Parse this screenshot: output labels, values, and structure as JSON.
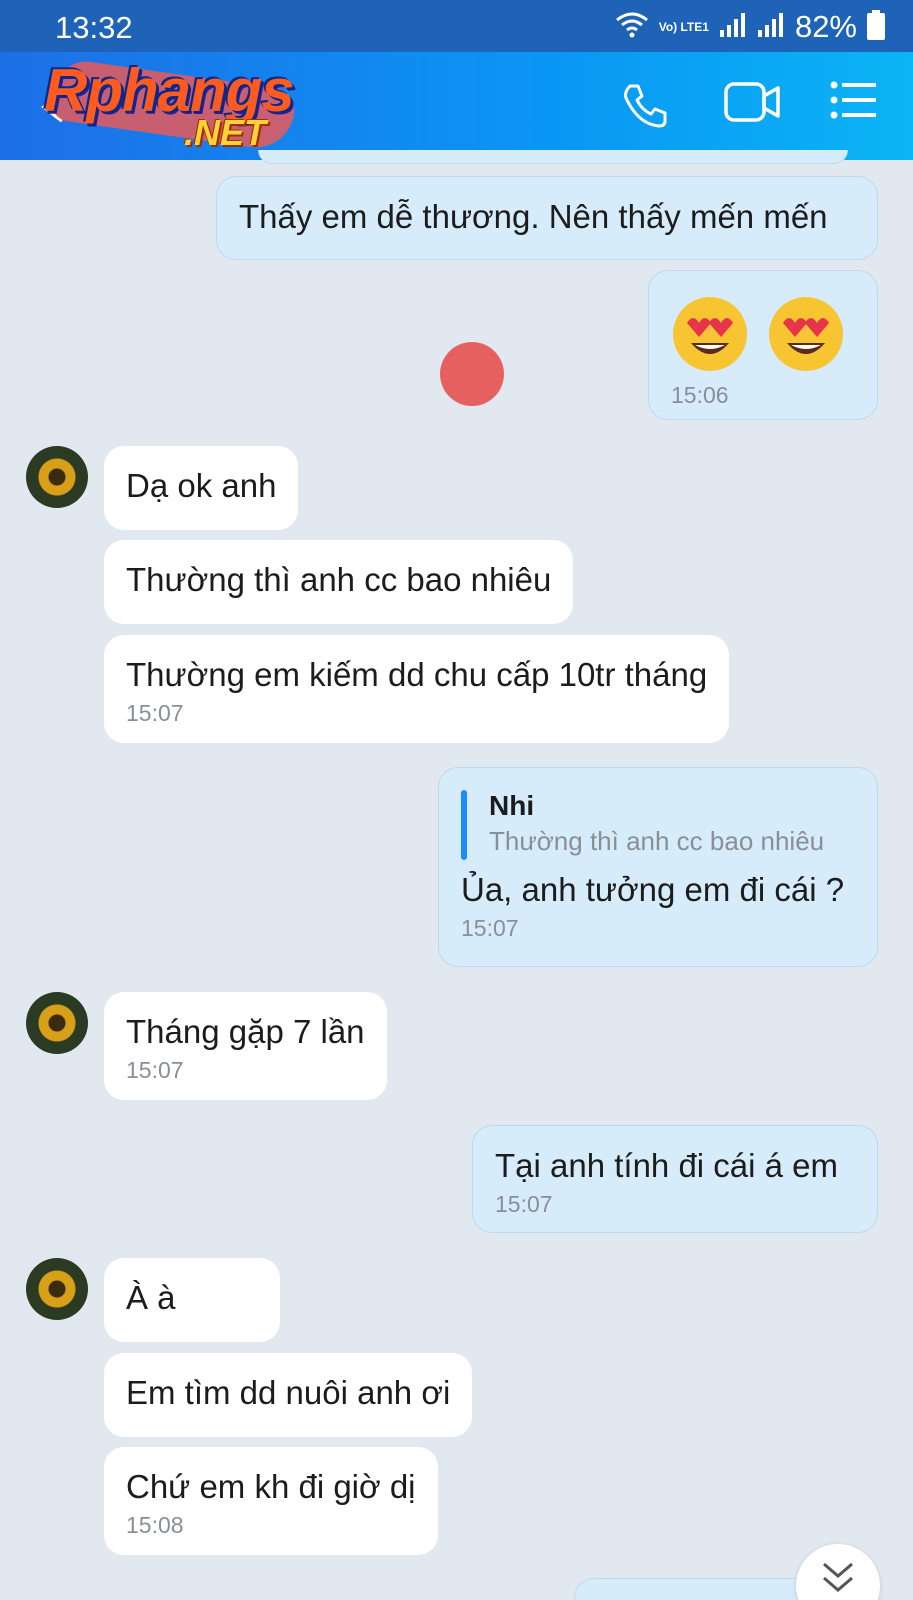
{
  "status_bar": {
    "time": "13:32",
    "network": "Vo) LTE1",
    "battery": "82%"
  },
  "header": {
    "logo_main": "Rphangs",
    "logo_sub": ".NET",
    "icons": [
      "back-arrow-icon",
      "phone-icon",
      "video-icon",
      "menu-list-icon"
    ]
  },
  "messages": [
    {
      "side": "me",
      "text": "Thấy em dễ thương. Nên thấy mến mến"
    },
    {
      "side": "me",
      "emojis": [
        "😍",
        "😍"
      ],
      "time": "15:06"
    },
    {
      "side": "them",
      "text": "Dạ ok anh"
    },
    {
      "side": "them",
      "text": "Thường thì anh cc bao nhiêu"
    },
    {
      "side": "them",
      "text": "Thường em kiếm dd chu cấp 10tr tháng",
      "time": "15:07"
    },
    {
      "side": "me",
      "reply_name": "Nhi",
      "reply_text": "Thường thì anh cc bao nhiêu",
      "text": "Ủa, anh tưởng em đi cái ?",
      "time": "15:07"
    },
    {
      "side": "them",
      "text": "Tháng gặp 7 lần",
      "time": "15:07"
    },
    {
      "side": "me",
      "text": "Tại anh tính đi cái á em",
      "time": "15:07"
    },
    {
      "side": "them",
      "text": "À à"
    },
    {
      "side": "them",
      "text": "Em tìm dd nuôi anh ơi"
    },
    {
      "side": "them",
      "text": "Chứ em kh đi giờ dị",
      "time": "15:08"
    }
  ],
  "colors": {
    "status_bar": "#1f63b8",
    "header_start": "#1e6fe6",
    "header_end": "#0bb4f5",
    "chat_bg": "#e2e8f0",
    "my_bubble": "#d6ecfb",
    "their_bubble": "#ffffff",
    "reply_accent": "#1a8cff"
  }
}
